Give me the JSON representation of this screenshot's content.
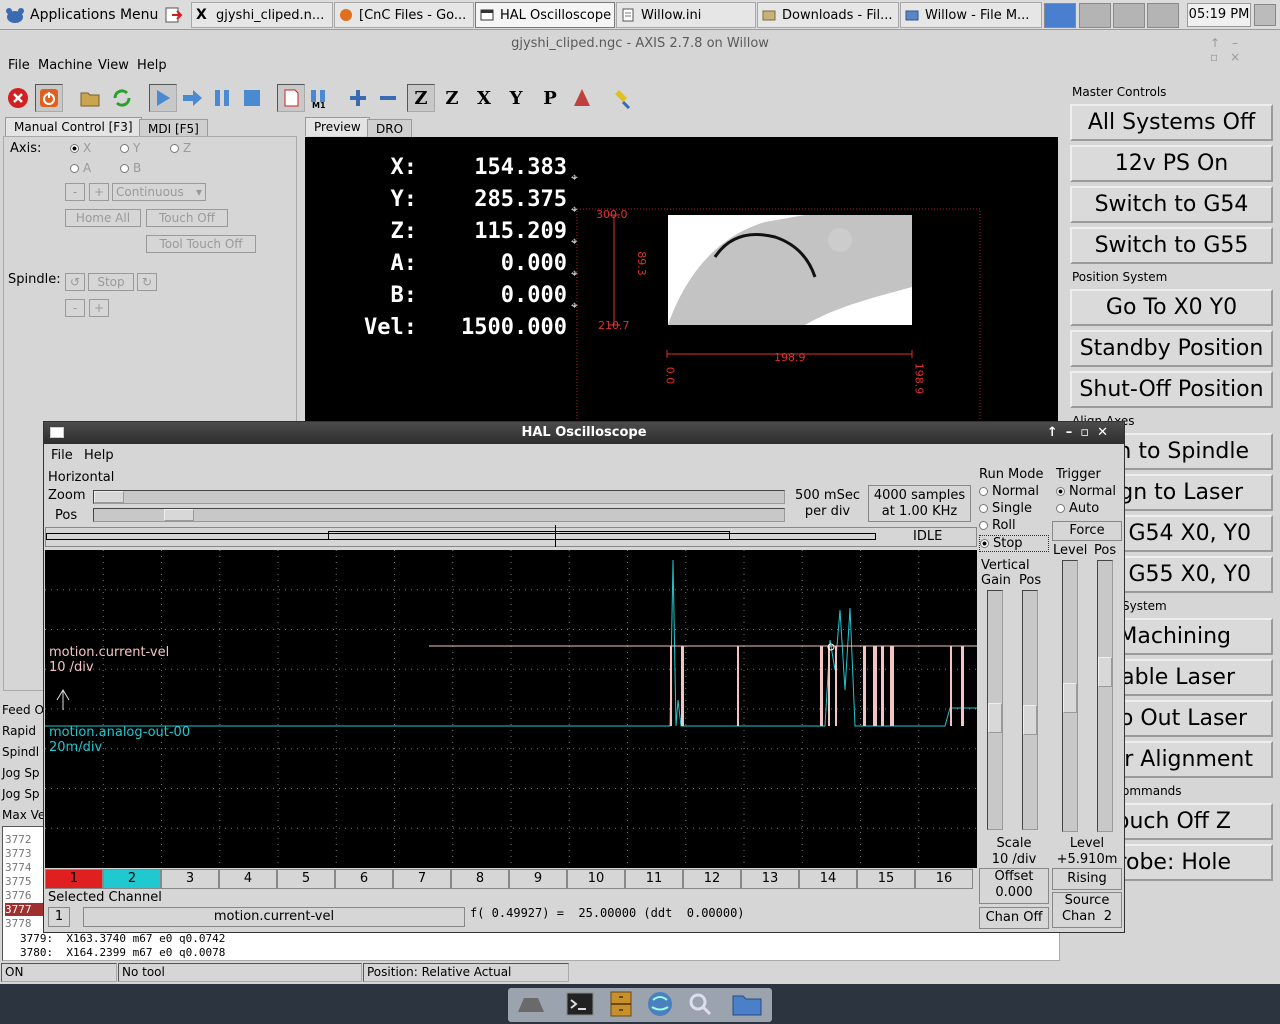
{
  "taskbar": {
    "apps_menu": "Applications Menu",
    "tasks": [
      {
        "label": "gjyshi_cliped.n..."
      },
      {
        "label": "[CnC Files - Go..."
      },
      {
        "label": "HAL Oscilloscope"
      },
      {
        "label": "Willow.ini"
      },
      {
        "label": "Downloads - Fil..."
      },
      {
        "label": "Willow - File M..."
      }
    ],
    "clock": "05:19 PM"
  },
  "axis": {
    "title": "gjyshi_cliped.ngc - AXIS 2.7.8 on Willow",
    "menu": [
      "File",
      "Machine",
      "View",
      "Help"
    ],
    "tabs": {
      "manual": "Manual Control [F3]",
      "mdi": "MDI [F5]",
      "preview": "Preview",
      "dro": "DRO"
    },
    "manual": {
      "axis_label": "Axis:",
      "axes": [
        "X",
        "Y",
        "Z",
        "A",
        "B"
      ],
      "minus": "-",
      "plus": "+",
      "jog_mode": "Continuous",
      "home_all": "Home All",
      "touch_off": "Touch Off",
      "tool_touch_off": "Tool Touch Off",
      "spindle_label": "Spindle:",
      "stop": "Stop"
    },
    "dro": [
      {
        "axis": "X:",
        "value": "154.383"
      },
      {
        "axis": "Y:",
        "value": "285.375"
      },
      {
        "axis": "Z:",
        "value": "115.209"
      },
      {
        "axis": "A:",
        "value": "0.000"
      },
      {
        "axis": "B:",
        "value": "0.000"
      },
      {
        "axis": "Vel:",
        "value": "1500.000"
      }
    ],
    "dims": {
      "top": "300.0",
      "height": "89.3",
      "bottom": "210.7",
      "width": "198.9",
      "xmin": "0.0",
      "xmax": "198.9"
    },
    "overrides": [
      "Feed O",
      "Rapid",
      "Spindl",
      "Jog Sp",
      "Jog Sp",
      "Max Ve"
    ],
    "gcode": [
      {
        "num": "3772",
        "text": ""
      },
      {
        "num": "3773",
        "text": ""
      },
      {
        "num": "3774",
        "text": ""
      },
      {
        "num": "3775",
        "text": ""
      },
      {
        "num": "3776",
        "text": ""
      },
      {
        "num": "3777",
        "text": ""
      },
      {
        "num": "3778",
        "text": ""
      },
      {
        "num": "3779:",
        "text": "X163.3740 m67 e0 q0.0742"
      },
      {
        "num": "3780:",
        "text": "X164.2399 m67 e0 q0.0078"
      }
    ],
    "status": {
      "state": "ON",
      "tool": "No tool",
      "position": "Position: Relative Actual"
    }
  },
  "master": {
    "master_title": "Master Controls",
    "master_buttons": [
      "All Systems Off",
      "12v PS On",
      "Switch to G54",
      "Switch to G55"
    ],
    "position_title": "Position System",
    "position_buttons": [
      "Go To X0 Y0",
      "Standby Position",
      "Shut-Off Position"
    ],
    "align_title": "Align Axes",
    "align_buttons": [
      "gn to Spindle",
      "gn to Laser",
      "t G54 X0, Y0",
      "t G55 X0, Y0"
    ],
    "system_title": "System",
    "system_buttons": [
      "Machining",
      "nable Laser",
      "ro Out Laser",
      "er Alignment"
    ],
    "commands_title": "ommands",
    "commands_buttons": [
      "ouch Off Z",
      "robe: Hole"
    ]
  },
  "osc": {
    "title": "HAL Oscilloscope",
    "menu": [
      "File",
      "Help"
    ],
    "horizontal": "Horizontal",
    "zoom": "Zoom",
    "pos": "Pos",
    "timebase": "500 mSec\nper div",
    "samples": "4000 samples\nat 1.00 KHz",
    "state": "IDLE",
    "run_mode": {
      "title": "Run Mode",
      "options": [
        "Normal",
        "Single",
        "Roll",
        "Stop"
      ],
      "selected": "Stop"
    },
    "trigger": {
      "title": "Trigger",
      "options": [
        "Normal",
        "Auto"
      ],
      "selected": "Normal",
      "force": "Force",
      "level": "Level",
      "pos": "Pos"
    },
    "vertical": {
      "title": "Vertical",
      "gain": "Gain",
      "pos": "Pos"
    },
    "scale": {
      "label": "Scale",
      "value": "10 /div"
    },
    "offset": {
      "label": "Offset",
      "value": "0.000"
    },
    "chan_off": "Chan Off",
    "trig_level": {
      "label": "Level",
      "value": "+5.910m"
    },
    "rising": "Rising",
    "source": {
      "label": "Source",
      "value": "Chan  2"
    },
    "traces": [
      {
        "name": "motion.current-vel",
        "scale": "10 /div",
        "color": "#f4c4c4"
      },
      {
        "name": "motion.analog-out-00",
        "scale": "20m/div",
        "color": "#20c8d0"
      }
    ],
    "channels": [
      "1",
      "2",
      "3",
      "4",
      "5",
      "6",
      "7",
      "8",
      "9",
      "10",
      "11",
      "12",
      "13",
      "14",
      "15",
      "16"
    ],
    "selected_channel": {
      "title": "Selected Channel",
      "num": "1",
      "name": "motion.current-vel",
      "readout": "f( 0.49927) =  25.00000 (ddt  0.00000)"
    }
  }
}
